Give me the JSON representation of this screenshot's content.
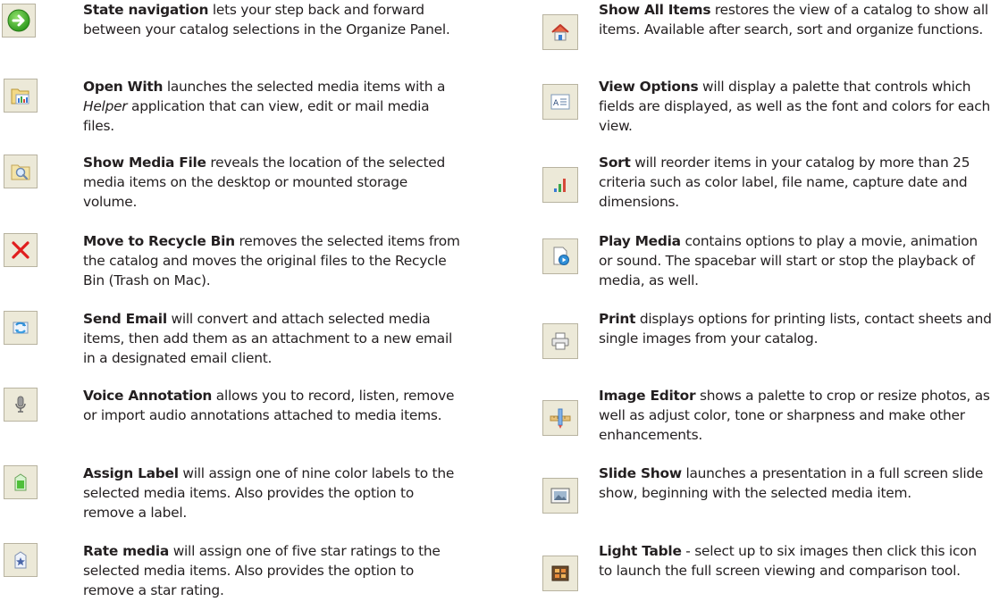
{
  "left_column": [
    {
      "title": "State navigation",
      "body": " lets your step back and forward between your catalog selections in the Organize Panel.",
      "icon": "arrow-right-icon"
    },
    {
      "title": "Open With",
      "body_pre": " launches the selected media items with a ",
      "body_em": "Helper",
      "body_post": " application that can view, edit or mail media files.",
      "icon": "open-with-icon"
    },
    {
      "title": "Show Media File",
      "body": " reveals the location of the selected media items on the desktop or mounted storage volume.",
      "icon": "show-media-file-icon"
    },
    {
      "title": "Move to Recycle Bin",
      "body": " removes the selected items from the catalog and moves the original files to the Recycle Bin (Trash on Mac).",
      "icon": "delete-x-icon"
    },
    {
      "title": "Send Email",
      "body": " will convert and attach selected media items, then add them as an attachment to a new email in a designated email client.",
      "icon": "send-email-icon"
    },
    {
      "title": "Voice Annotation",
      "body": " allows you to record, listen, remove or import audio annotations attached to media items.",
      "icon": "microphone-icon"
    },
    {
      "title": "Assign Label",
      "body": " will assign one of nine color labels to the selected media items. Also provides the option to remove a label.",
      "icon": "label-icon"
    },
    {
      "title": "Rate media",
      "body": " will assign one of five star ratings to the selected media items. Also provides the option to remove a star rating.",
      "icon": "star-rating-icon"
    }
  ],
  "right_column": [
    {
      "title": "Show All Items",
      "body": " restores the view of a catalog to show all items. Available after search, sort and organize functions.",
      "icon": "home-icon"
    },
    {
      "title": "View Options",
      "body": " will display a palette that controls which fields are displayed, as well as the font and colors for each view.",
      "icon": "view-options-icon"
    },
    {
      "title": "Sort",
      "body": " will reorder items in your catalog by more than 25 criteria such as color label, file name, capture date and dimensions.",
      "icon": "sort-bars-icon"
    },
    {
      "title": "Play Media",
      "body": " contains options to play a movie, animation or sound. The spacebar will start or stop the playback of media, as well.",
      "icon": "play-media-icon"
    },
    {
      "title": "Print",
      "body": " displays options for printing lists, contact sheets and single images from your catalog.",
      "icon": "printer-icon"
    },
    {
      "title": "Image Editor",
      "body": " shows a palette to crop or resize photos, as well as adjust color, tone or sharpness and make other enhancements.",
      "icon": "image-editor-icon"
    },
    {
      "title": "Slide Show",
      "body": " launches a presentation in a full screen slide show, beginning with the selected media item.",
      "icon": "slide-show-icon"
    },
    {
      "title": "Light Table",
      "body": " - select up to six images then click this icon to launch the full screen viewing and comparison tool.",
      "icon": "light-table-icon"
    }
  ]
}
